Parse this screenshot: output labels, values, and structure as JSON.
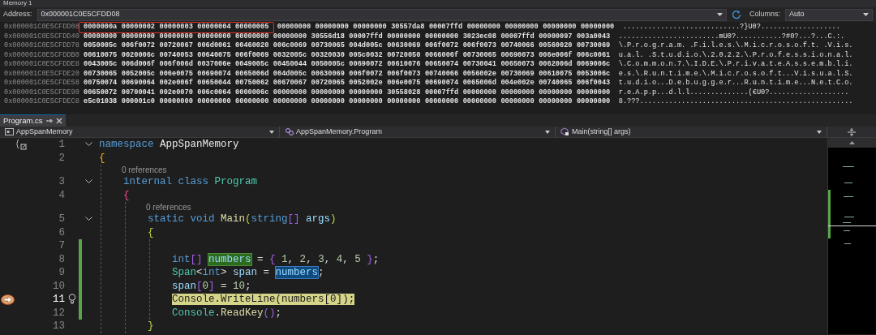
{
  "memory": {
    "title": "Memory 1",
    "address_label": "Address:",
    "address": "0x000001C0E5CFDD08",
    "columns_label": "Columns:",
    "columns": "Auto",
    "rows": [
      {
        "address": "0x000001C0E5CFDD08",
        "boxed_words": [
          "0000000a",
          "00000002",
          "00000003",
          "00000004",
          "00000005"
        ],
        "words": [
          "00000000",
          "00000000",
          "00000000",
          "30557da8",
          "00007ffd",
          "00000000",
          "00000000",
          "00000000",
          "00000000"
        ],
        "ascii": "............................?}U0?..................."
      },
      {
        "address": "0x000001C0E5CFDD40",
        "words": [
          "00000000",
          "00000000",
          "00000000",
          "00000000",
          "00000000",
          "00000000",
          "30556d18",
          "00007ffd",
          "00000000",
          "00000000",
          "3023ec08",
          "00007ffd",
          "00000097",
          "003a0043"
        ],
        "ascii": "........................mU0?...........?#0?...?...C.:."
      },
      {
        "address": "0x000001C0E5CFDD78",
        "words": [
          "0050005c",
          "006f0072",
          "00720067",
          "006d0061",
          "00460020",
          "006c0069",
          "00730065",
          "004d005c",
          "00630069",
          "006f0072",
          "006f0073",
          "00740066",
          "00560020",
          "00730069"
        ],
        "ascii": "\\.P.r.o.g.r.a.m. .F.i.l.e.s.\\.M.i.c.r.o.s.o.f.t. .V.i.s."
      },
      {
        "address": "0x000001C0E5CFDDB0",
        "words": [
          "00610075",
          "0020006c",
          "00740053",
          "00640075",
          "006f0069",
          "0032005c",
          "00320030",
          "005c0032",
          "00720050",
          "0066006f",
          "00730065",
          "00690073",
          "006e006f",
          "006c0061"
        ],
        "ascii": "u.a.l. .S.t.u.d.i.o.\\.2.0.2.2.\\.P.r.o.f.e.s.s.i.o.n.a.l."
      },
      {
        "address": "0x000001C0E5CFDDE8",
        "words": [
          "0043005c",
          "006d006f",
          "006f006d",
          "0037006e",
          "0049005c",
          "00450044",
          "0050005c",
          "00690072",
          "00610076",
          "00650074",
          "00730041",
          "00650073",
          "0062006d",
          "0069006c"
        ],
        "ascii": "\\.C.o.m.m.o.n.7.\\.I.D.E.\\.P.r.i.v.a.t.e.A.s.s.e.m.b.l.i."
      },
      {
        "address": "0x000001C0E5CFDE20",
        "words": [
          "00730065",
          "0052005c",
          "006e0075",
          "00690074",
          "0065006d",
          "004d005c",
          "00630069",
          "006f0072",
          "006f0073",
          "00740066",
          "0056002e",
          "00730069",
          "00610075",
          "0053006c"
        ],
        "ascii": "e.s.\\.R.u.n.t.i.m.e.\\.M.i.c.r.o.s.o.f.t...V.i.s.u.a.l.S."
      },
      {
        "address": "0x000001C0E5CFDE58",
        "words": [
          "00750074",
          "00690064",
          "002e006f",
          "00650044",
          "00750062",
          "00670067",
          "00720065",
          "0052002e",
          "006e0075",
          "00690074",
          "0065006d",
          "004e002e",
          "00740065",
          "006f0043"
        ],
        "ascii": "t.u.d.i.o...D.e.b.u.g.g.e.r...R.u.n.t.i.m.e...N.e.t.C.o."
      },
      {
        "address": "0x000001C0E5CFDE90",
        "words": [
          "00650072",
          "00700041",
          "002e0070",
          "006c0064",
          "0000006c",
          "00000000",
          "00000000",
          "00000000",
          "30558028",
          "00007ffd",
          "00000000",
          "00000000",
          "00000000",
          "00000000"
        ],
        "ascii": "r.e.A.p.p...d.l.l..............(€U0?..................."
      },
      {
        "address": "0x000001C0E5CFDEC8",
        "words": [
          "e5c01038",
          "000001c0",
          "00000000",
          "00000000",
          "00000000",
          "00000000",
          "00000000",
          "00000000",
          "00000000",
          "00000000",
          "00000000",
          "00000000",
          "00000000",
          "00000000"
        ],
        "ascii": "8.???..................................................."
      }
    ]
  },
  "editor": {
    "tab": {
      "label": "Program.cs",
      "selected": true
    },
    "nav": [
      "AppSpanMemory",
      "AppSpanMemory.Program",
      "Main(string[] args)"
    ],
    "lines": [
      {
        "kind": "code",
        "number": "1",
        "fold": true,
        "changed": false,
        "current": false,
        "tokens": [
          {
            "text": "namespace ",
            "kind": "keyword"
          },
          {
            "text": "AppSpanMemory",
            "kind": "name"
          }
        ]
      },
      {
        "kind": "code",
        "number": "2",
        "fold": false,
        "changed": false,
        "current": false,
        "tokens": [
          {
            "text": "{",
            "kind": "gold"
          }
        ]
      },
      {
        "kind": "block",
        "children": [
          {
            "kind": "lens",
            "text": "0 references"
          },
          {
            "kind": "code",
            "number": "3",
            "fold": true,
            "changed": false,
            "current": false,
            "tokens": [
              {
                "text": "internal ",
                "kind": "keyword"
              },
              {
                "text": "class ",
                "kind": "keyword"
              },
              {
                "text": "Program",
                "kind": "type"
              }
            ]
          },
          {
            "kind": "code",
            "number": "4",
            "fold": false,
            "changed": false,
            "current": false,
            "tokens": [
              {
                "text": "{",
                "kind": "pink"
              }
            ]
          },
          {
            "kind": "block",
            "children": [
              {
                "kind": "lens",
                "text": "0 references"
              },
              {
                "kind": "code",
                "number": "5",
                "fold": true,
                "changed": false,
                "current": false,
                "tokens": [
                  {
                    "text": "static ",
                    "kind": "keyword"
                  },
                  {
                    "text": "void ",
                    "kind": "keyword"
                  },
                  {
                    "text": "Main",
                    "kind": "method"
                  },
                  {
                    "text": "(",
                    "kind": "lime"
                  },
                  {
                    "text": "string",
                    "kind": "keyword"
                  },
                  {
                    "text": "[] ",
                    "kind": "purple"
                  },
                  {
                    "text": "args",
                    "kind": "local"
                  },
                  {
                    "text": ")",
                    "kind": "lime"
                  }
                ]
              },
              {
                "kind": "code",
                "number": "6",
                "fold": false,
                "changed": false,
                "current": false,
                "tokens": [
                  {
                    "text": "{",
                    "kind": "lime"
                  }
                ]
              },
              {
                "kind": "block",
                "children": [
                  {
                    "kind": "code",
                    "number": "7",
                    "fold": false,
                    "changed": true,
                    "current": false
                  },
                  {
                    "kind": "code",
                    "number": "8",
                    "fold": false,
                    "changed": true,
                    "current": false,
                    "tokens": [
                      {
                        "text": "int",
                        "kind": "keyword"
                      },
                      {
                        "text": "[] ",
                        "kind": "purple"
                      },
                      {
                        "text": "numbers",
                        "kind": "definition"
                      },
                      {
                        "text": " = ",
                        "kind": "plain"
                      },
                      {
                        "text": "{ ",
                        "kind": "purple"
                      },
                      {
                        "text": "1",
                        "kind": "number"
                      },
                      {
                        "text": ", ",
                        "kind": "plain"
                      },
                      {
                        "text": "2",
                        "kind": "number"
                      },
                      {
                        "text": ", ",
                        "kind": "plain"
                      },
                      {
                        "text": "3",
                        "kind": "number"
                      },
                      {
                        "text": ", ",
                        "kind": "plain"
                      },
                      {
                        "text": "4",
                        "kind": "number"
                      },
                      {
                        "text": ", ",
                        "kind": "plain"
                      },
                      {
                        "text": "5",
                        "kind": "number"
                      },
                      {
                        "text": " }",
                        "kind": "purple"
                      },
                      {
                        "text": ";",
                        "kind": "plain"
                      }
                    ]
                  },
                  {
                    "kind": "code",
                    "number": "9",
                    "fold": false,
                    "changed": true,
                    "current": false,
                    "tokens": [
                      {
                        "text": "Span",
                        "kind": "type"
                      },
                      {
                        "text": "<",
                        "kind": "plain"
                      },
                      {
                        "text": "int",
                        "kind": "keyword"
                      },
                      {
                        "text": "> ",
                        "kind": "plain"
                      },
                      {
                        "text": "span",
                        "kind": "local"
                      },
                      {
                        "text": " = ",
                        "kind": "plain"
                      },
                      {
                        "text": "numbers",
                        "kind": "reference"
                      },
                      {
                        "text": ";",
                        "kind": "plain"
                      }
                    ]
                  },
                  {
                    "kind": "code",
                    "number": "10",
                    "fold": false,
                    "changed": true,
                    "current": false,
                    "tokens": [
                      {
                        "text": "span",
                        "kind": "local"
                      },
                      {
                        "text": "[",
                        "kind": "purple"
                      },
                      {
                        "text": "0",
                        "kind": "number"
                      },
                      {
                        "text": "]",
                        "kind": "purple"
                      },
                      {
                        "text": " = ",
                        "kind": "plain"
                      },
                      {
                        "text": "10",
                        "kind": "number"
                      },
                      {
                        "text": ";",
                        "kind": "plain"
                      }
                    ]
                  },
                  {
                    "kind": "code",
                    "number": "11",
                    "fold": false,
                    "changed": true,
                    "current": true,
                    "tokens": [
                      {
                        "text": "Console",
                        "kind": "type"
                      },
                      {
                        "text": ".",
                        "kind": "plain"
                      },
                      {
                        "text": "WriteLine",
                        "kind": "method"
                      },
                      {
                        "text": "(",
                        "kind": "lime"
                      },
                      {
                        "text": "numbers",
                        "kind": "local"
                      },
                      {
                        "text": "[",
                        "kind": "purple"
                      },
                      {
                        "text": "0",
                        "kind": "number"
                      },
                      {
                        "text": "]",
                        "kind": "purple"
                      },
                      {
                        "text": ")",
                        "kind": "lime"
                      },
                      {
                        "text": ";",
                        "kind": "plain"
                      }
                    ]
                  },
                  {
                    "kind": "code",
                    "number": "12",
                    "fold": false,
                    "changed": true,
                    "current": false,
                    "tokens": [
                      {
                        "text": "Console",
                        "kind": "type"
                      },
                      {
                        "text": ".",
                        "kind": "plain"
                      },
                      {
                        "text": "ReadKey",
                        "kind": "method"
                      },
                      {
                        "text": "()",
                        "kind": "purple"
                      },
                      {
                        "text": ";",
                        "kind": "plain"
                      }
                    ]
                  }
                ]
              },
              {
                "kind": "code",
                "number": "13",
                "fold": false,
                "changed": false,
                "current": false,
                "tokens": [
                  {
                    "text": "}",
                    "kind": "lime"
                  }
                ]
              }
            ]
          }
        ]
      }
    ]
  }
}
